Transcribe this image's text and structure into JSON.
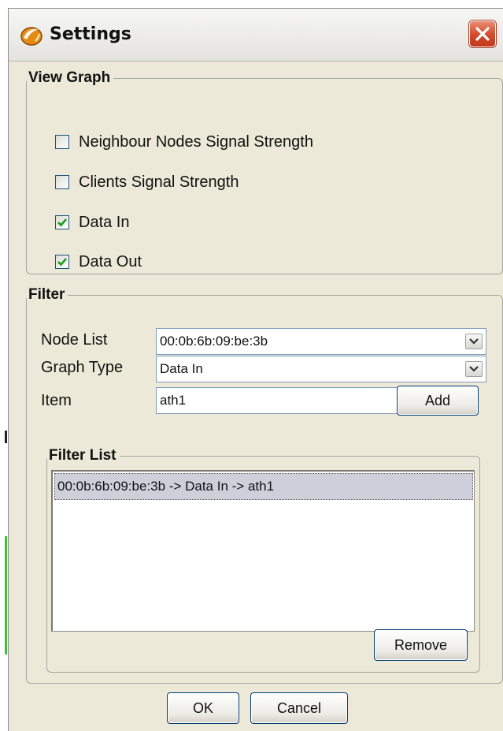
{
  "window": {
    "title": "Settings"
  },
  "view_graph": {
    "legend": "View Graph",
    "options": [
      {
        "label": "Neighbour Nodes Signal Strength",
        "checked": false
      },
      {
        "label": "Clients Signal Strength",
        "checked": false
      },
      {
        "label": "Data In",
        "checked": true
      },
      {
        "label": "Data Out",
        "checked": true
      }
    ]
  },
  "filter": {
    "legend": "Filter",
    "node_list_label": "Node List",
    "node_list_value": "00:0b:6b:09:be:3b",
    "graph_type_label": "Graph Type",
    "graph_type_value": "Data In",
    "item_label": "Item",
    "item_value": "ath1",
    "add_label": "Add"
  },
  "filter_list": {
    "legend": "Filter List",
    "items": [
      "00:0b:6b:09:be:3b -> Data In -> ath1"
    ],
    "remove_label": "Remove"
  },
  "footer": {
    "ok_label": "OK",
    "cancel_label": "Cancel"
  },
  "colors": {
    "accent_check": "#21a121",
    "close_button": "#d24a2a"
  }
}
